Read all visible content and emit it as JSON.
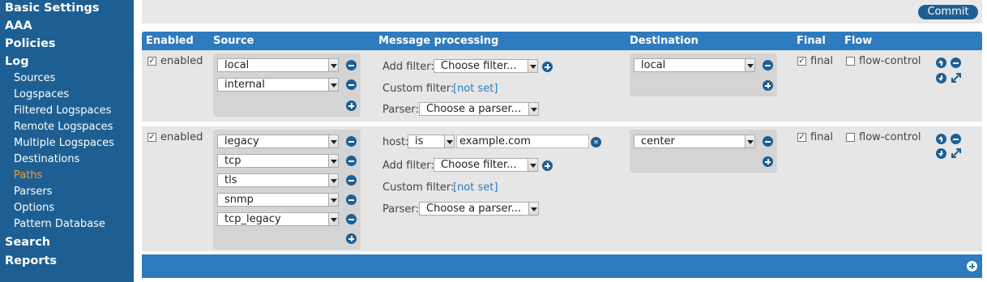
{
  "sidebar": {
    "top_items": [
      "Basic Settings",
      "AAA",
      "Policies",
      "Log"
    ],
    "log_items": [
      "Sources",
      "Logspaces",
      "Filtered Logspaces",
      "Remote Logspaces",
      "Multiple Logspaces",
      "Destinations",
      "Paths",
      "Parsers",
      "Options",
      "Pattern Database"
    ],
    "active_item": "Paths",
    "bottom_items": [
      "Search",
      "Reports"
    ]
  },
  "toolbar": {
    "commit_label": "Commit"
  },
  "table": {
    "headers": [
      "Enabled",
      "Source",
      "Message processing",
      "Destination",
      "Final",
      "Flow"
    ]
  },
  "paths": [
    {
      "enabled_label": "enabled",
      "sources": [
        "local",
        "internal"
      ],
      "add_filter_label": "Add filter:",
      "filter_select": "Choose filter...",
      "custom_filter_label": "Custom filter:",
      "custom_filter_value": "[not set]",
      "parser_label": "Parser:",
      "parser_select": "Choose a parser...",
      "destinations": [
        "local"
      ],
      "final_label": "final",
      "flow_label": "flow-control"
    },
    {
      "enabled_label": "enabled",
      "sources": [
        "legacy",
        "tcp",
        "tls",
        "snmp",
        "tcp_legacy"
      ],
      "host_filter": {
        "label": "host:",
        "operator": "is",
        "value": "example.com"
      },
      "add_filter_label": "Add filter:",
      "filter_select": "Choose filter...",
      "custom_filter_label": "Custom filter:",
      "custom_filter_value": "[not set]",
      "parser_label": "Parser:",
      "parser_select": "Choose a parser...",
      "destinations": [
        "center"
      ],
      "final_label": "final",
      "flow_label": "flow-control"
    }
  ],
  "colors": {
    "sidebar_bg": "#1d5f92",
    "header_bg": "#2e7bbf",
    "active_nav": "#f0a030",
    "row_bg": "#e6e6e6"
  }
}
